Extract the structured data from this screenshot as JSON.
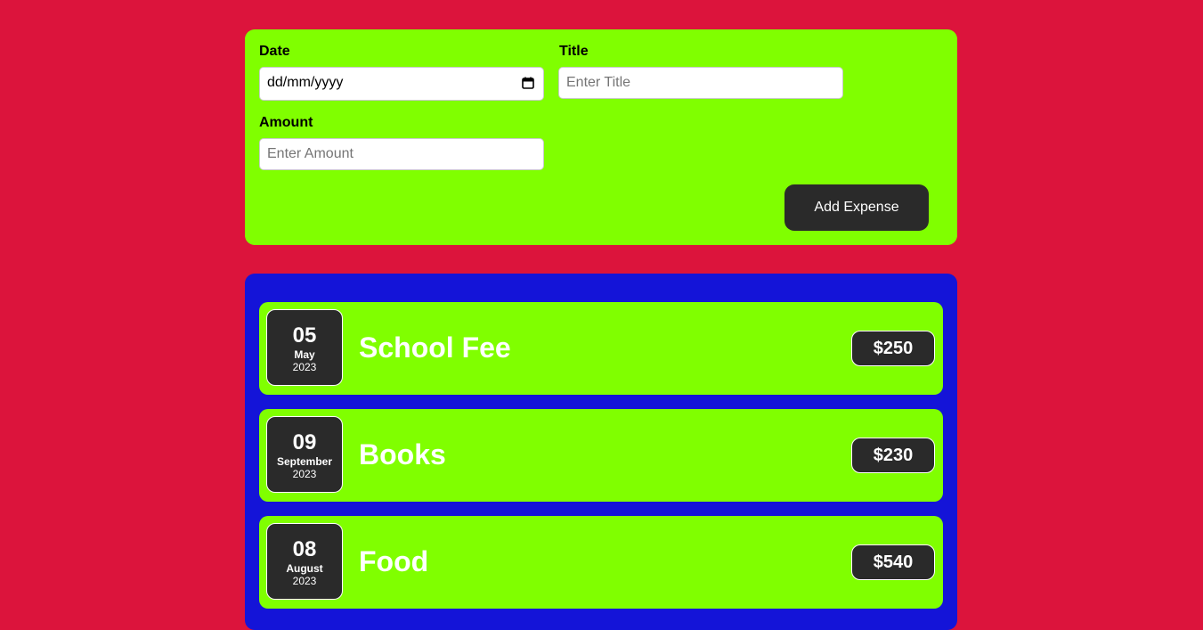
{
  "form": {
    "date_label": "Date",
    "date_value": "dd/mm/yyyy",
    "title_label": "Title",
    "title_placeholder": "Enter Title",
    "amount_label": "Amount",
    "amount_placeholder": "Enter Amount",
    "add_button_label": "Add Expense"
  },
  "expenses": [
    {
      "day": "05",
      "month": "May",
      "year": "2023",
      "title": "School Fee",
      "amount": "$250"
    },
    {
      "day": "09",
      "month": "September",
      "year": "2023",
      "title": "Books",
      "amount": "$230"
    },
    {
      "day": "08",
      "month": "August",
      "year": "2023",
      "title": "Food",
      "amount": "$540"
    }
  ],
  "colors": {
    "page_background": "#dc143c",
    "form_background": "#80ff00",
    "list_background": "#1414d8",
    "item_background": "#80ff00",
    "dark_box": "#2a2a2a"
  },
  "icons": {
    "date_picker": "calendar-icon"
  }
}
